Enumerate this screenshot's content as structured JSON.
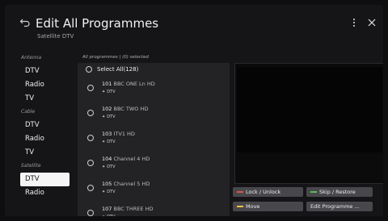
{
  "header": {
    "title": "Edit All Programmes",
    "subtitle": "Satellite DTV"
  },
  "sidebar": {
    "groups": [
      {
        "label": "Antenna",
        "items": [
          "DTV",
          "Radio",
          "TV"
        ]
      },
      {
        "label": "Cable",
        "items": [
          "DTV",
          "Radio",
          "TV"
        ]
      },
      {
        "label": "Satellite",
        "items": [
          "DTV",
          "Radio"
        ]
      }
    ],
    "active": "Satellite DTV"
  },
  "list": {
    "header": "All programmes | (0) selected",
    "select_all": "Select All(128)",
    "programmes": [
      {
        "number": "101",
        "name": "BBC ONE Ln HD",
        "type": "DTV"
      },
      {
        "number": "102",
        "name": "BBC TWO HD",
        "type": "DTV"
      },
      {
        "number": "103",
        "name": "ITV1 HD",
        "type": "DTV"
      },
      {
        "number": "104",
        "name": "Channel 4 HD",
        "type": "DTV"
      },
      {
        "number": "105",
        "name": "Channel 5 HD",
        "type": "DTV"
      },
      {
        "number": "107",
        "name": "BBC THREE HD",
        "type": "DTV"
      }
    ]
  },
  "buttons": {
    "lock_unlock": {
      "label": "Lock / Unlock",
      "color": "#d9534f"
    },
    "skip_restore": {
      "label": "Skip / Restore",
      "color": "#5cb85c"
    },
    "move": {
      "label": "Move",
      "color": "#f0c040"
    },
    "edit_programme": {
      "label": "Edit Programme ..."
    }
  },
  "colors": {
    "background": "#151518",
    "panel": "#232325",
    "active_item": "#f5f5f5"
  }
}
